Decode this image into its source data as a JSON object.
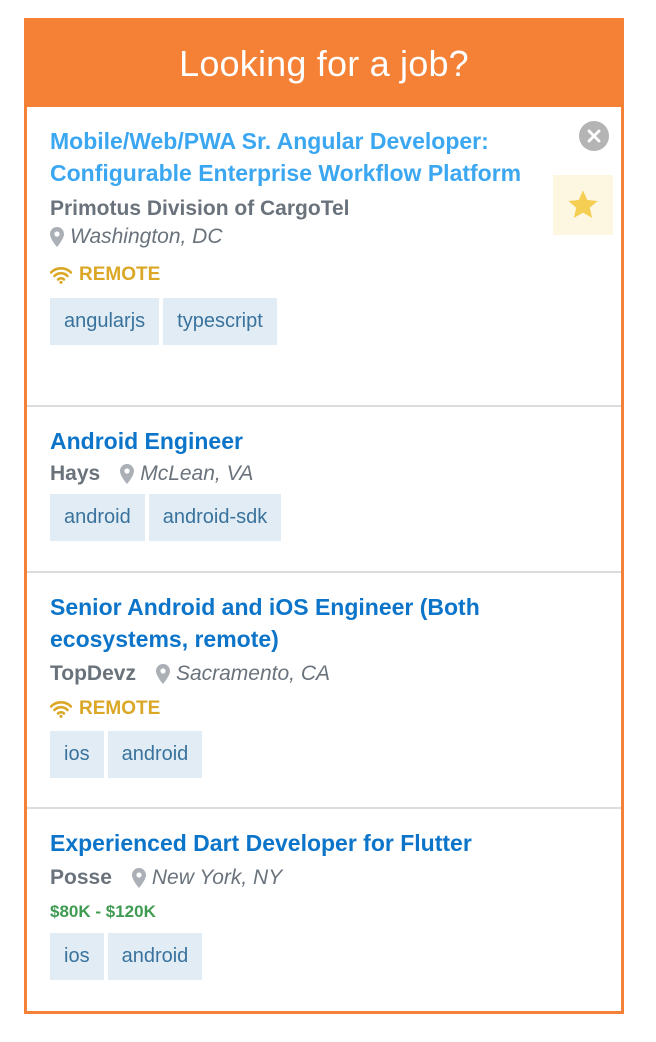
{
  "header": {
    "title": "Looking for a job?"
  },
  "colors": {
    "brand": "#f48136",
    "link": "#0c75c9",
    "link_highlight": "#3ba7f1",
    "remote": "#dba727",
    "salary": "#3f9b52",
    "tag_bg": "#e1ecf4",
    "tag_text": "#39739d"
  },
  "icons": {
    "close": "close-icon",
    "star": "star-icon",
    "location": "location-pin-icon",
    "remote": "wifi-icon"
  },
  "jobs": [
    {
      "title": "Mobile/Web/PWA Sr. Angular Developer: Configurable Enterprise Workflow Platform",
      "company": "Primotus Division of CargoTel",
      "location": "Washington, DC",
      "remote_label": "REMOTE",
      "tags": [
        "angularjs",
        "typescript"
      ]
    },
    {
      "title": "Android Engineer",
      "company": "Hays",
      "location": "McLean, VA",
      "tags": [
        "android",
        "android-sdk"
      ]
    },
    {
      "title": "Senior Android and iOS Engineer (Both ecosystems, remote)",
      "company": "TopDevz",
      "location": "Sacramento, CA",
      "remote_label": "REMOTE",
      "tags": [
        "ios",
        "android"
      ]
    },
    {
      "title": "Experienced Dart Developer for Flutter",
      "company": "Posse",
      "location": "New York, NY",
      "salary": "$80K - $120K",
      "tags": [
        "ios",
        "android"
      ]
    }
  ]
}
